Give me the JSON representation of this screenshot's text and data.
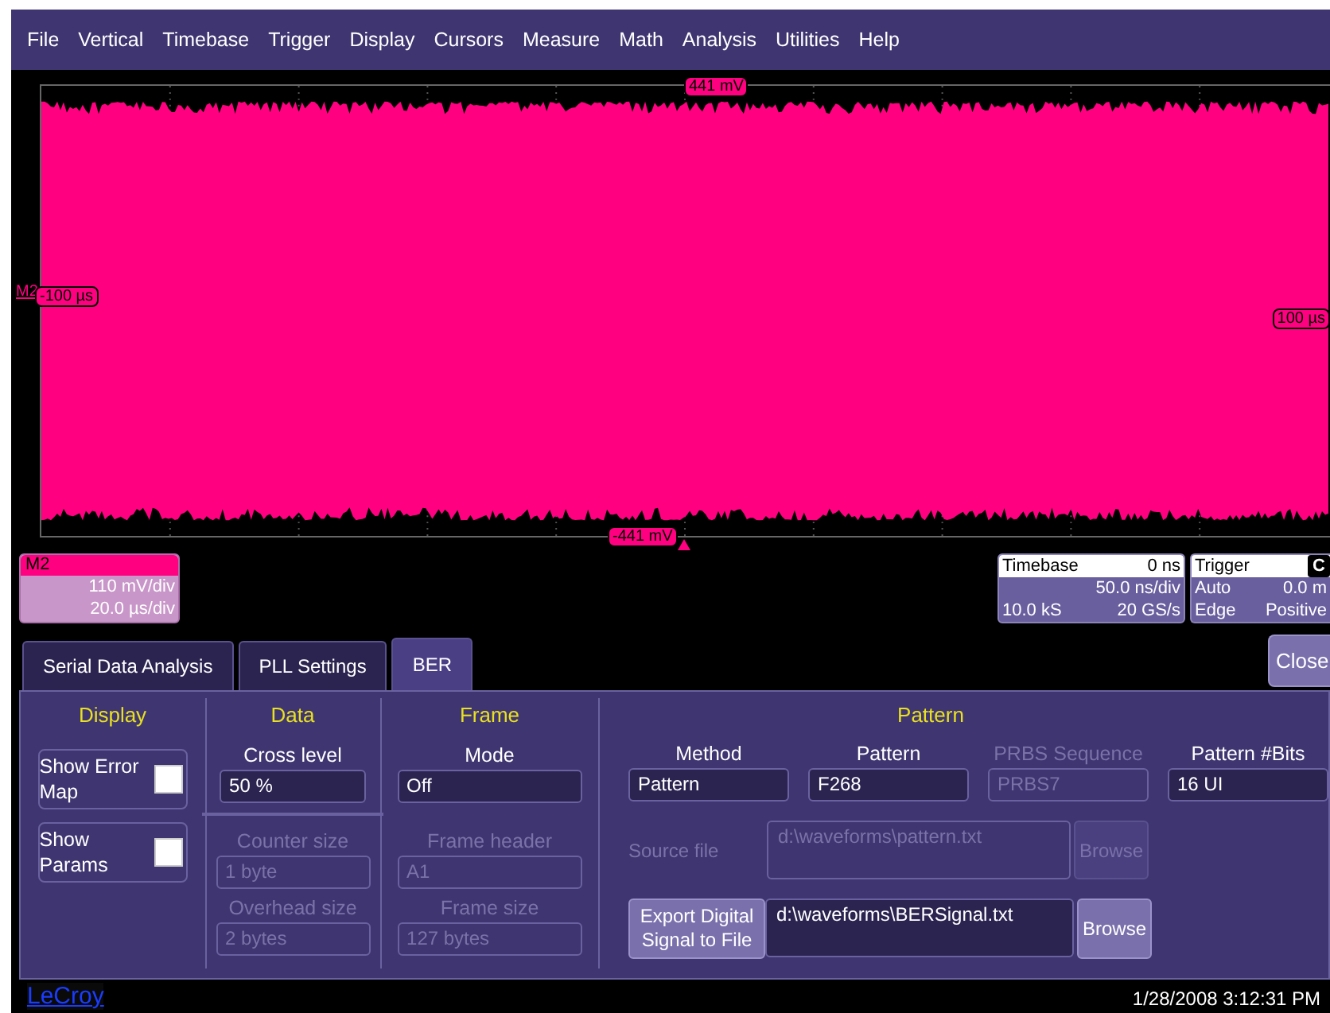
{
  "menu": [
    "File",
    "Vertical",
    "Timebase",
    "Trigger",
    "Display",
    "Cursors",
    "Measure",
    "Math",
    "Analysis",
    "Utilities",
    "Help"
  ],
  "scope": {
    "top_level": "441 mV",
    "bottom_level": "-441 mV",
    "left_time": "-100 µs",
    "right_time": "100 µs",
    "trace_tag": "M2"
  },
  "channel_box": {
    "name": "M2",
    "volts_per_div": "110 mV/div",
    "time_per_div": "20.0 µs/div"
  },
  "timebase": {
    "title": "Timebase",
    "delay": "0 ns",
    "time_per_div": "50.0 ns/div",
    "samples": "10.0 kS",
    "sample_rate": "20 GS/s"
  },
  "trigger": {
    "title": "Trigger",
    "source": "C",
    "level": "0.0 m",
    "mode": "Auto",
    "type": "Edge",
    "slope": "Positive"
  },
  "tabs": [
    {
      "label": "Serial Data Analysis",
      "selected": false
    },
    {
      "label": "PLL Settings",
      "selected": false
    },
    {
      "label": "BER",
      "selected": true
    }
  ],
  "close_button": "Close",
  "panel": {
    "display": {
      "title": "Display",
      "checkboxes": [
        {
          "label": "Show Error Map",
          "checked": false
        },
        {
          "label": "Show Params",
          "checked": false
        }
      ]
    },
    "data": {
      "title": "Data",
      "fields": [
        {
          "label": "Cross level",
          "value": "50 %",
          "disabled": false
        },
        {
          "label": "Counter size",
          "value": "1 byte",
          "disabled": true
        },
        {
          "label": "Overhead size",
          "value": "2 bytes",
          "disabled": true
        }
      ]
    },
    "frame": {
      "title": "Frame",
      "fields": [
        {
          "label": "Mode",
          "value": "Off",
          "disabled": false
        },
        {
          "label": "Frame header",
          "value": "A1",
          "disabled": true
        },
        {
          "label": "Frame size",
          "value": "127 bytes",
          "disabled": true
        }
      ]
    },
    "pattern": {
      "title": "Pattern",
      "fields": [
        {
          "label": "Method",
          "value": "Pattern",
          "disabled": false
        },
        {
          "label": "Pattern",
          "value": "F268",
          "disabled": false
        },
        {
          "label": "PRBS Sequence",
          "value": "PRBS7",
          "disabled": true
        },
        {
          "label": "Pattern #Bits",
          "value": "16 UI",
          "disabled": false
        }
      ],
      "source_file": {
        "label": "Source file",
        "value": "d:\\waveforms\\pattern.txt",
        "button": "Browse",
        "disabled": true
      },
      "export": {
        "button": "Export Digital Signal to File",
        "value": "d:\\waveforms\\BERSignal.txt",
        "browse": "Browse",
        "disabled": false
      }
    }
  },
  "footer": {
    "brand": "LeCroy",
    "datetime": "1/28/2008 3:12:31 PM"
  }
}
